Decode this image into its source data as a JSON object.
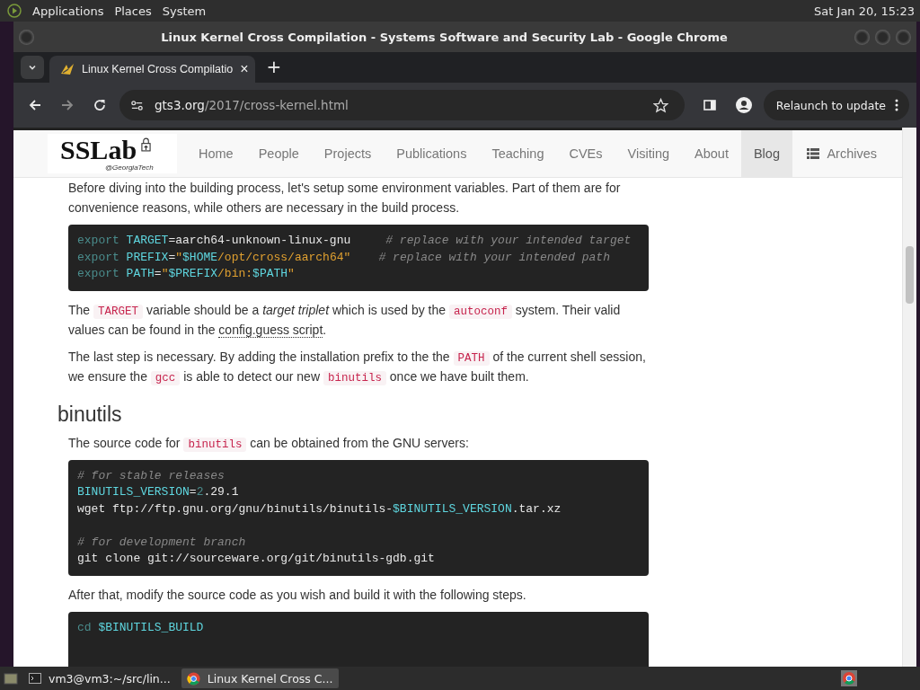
{
  "top_panel": {
    "menus": [
      "Applications",
      "Places",
      "System"
    ],
    "clock": "Sat Jan 20, 15:23"
  },
  "window": {
    "title": "Linux Kernel Cross Compilation - Systems Software and Security Lab - Google Chrome"
  },
  "tabs": [
    {
      "label": "Linux Kernel Cross Compilatio",
      "selected": true,
      "close": "×"
    }
  ],
  "new_tab": "+",
  "address": {
    "host": "gts3.org",
    "path": "/2017/cross-kernel.html"
  },
  "relaunch": "Relaunch to update",
  "site_nav": {
    "logo": "SSLab",
    "logo_sub": "@GeorgiaTech",
    "items": [
      {
        "label": "Home",
        "selected": false
      },
      {
        "label": "People",
        "selected": false
      },
      {
        "label": "Projects",
        "selected": false
      },
      {
        "label": "Publications",
        "selected": false
      },
      {
        "label": "Teaching",
        "selected": false
      },
      {
        "label": "CVEs",
        "selected": false
      },
      {
        "label": "Visiting",
        "selected": false
      },
      {
        "label": "About",
        "selected": false
      },
      {
        "label": "Blog",
        "selected": true
      }
    ],
    "archives": "Archives"
  },
  "content": [
    {
      "kind": "para",
      "segs": [
        {
          "kind": "text",
          "text": "Before diving into the building process, let's setup some environment variables. Part of them are for convenience reasons, while others are necessary in the build process."
        }
      ]
    },
    {
      "kind": "code",
      "lines": [
        {
          "segs": [
            {
              "kind": "keyword",
              "text": "export "
            },
            {
              "kind": "variable",
              "text": "TARGET"
            },
            {
              "kind": "plain",
              "text": "=aarch64-unknown-linux-gnu     "
            },
            {
              "kind": "comment",
              "text": "# replace with your intended target"
            }
          ]
        },
        {
          "segs": [
            {
              "kind": "keyword",
              "text": "export "
            },
            {
              "kind": "variable",
              "text": "PREFIX"
            },
            {
              "kind": "plain",
              "text": "="
            },
            {
              "kind": "string",
              "text": "\""
            },
            {
              "kind": "variable",
              "text": "$HOME"
            },
            {
              "kind": "string",
              "text": "/opt/cross/aarch64\"    "
            },
            {
              "kind": "comment",
              "text": "# replace with your intended path"
            }
          ]
        },
        {
          "segs": [
            {
              "kind": "keyword",
              "text": "export "
            },
            {
              "kind": "variable",
              "text": "PATH"
            },
            {
              "kind": "plain",
              "text": "="
            },
            {
              "kind": "string",
              "text": "\""
            },
            {
              "kind": "variable",
              "text": "$PREFIX"
            },
            {
              "kind": "string",
              "text": "/bin:"
            },
            {
              "kind": "variable",
              "text": "$PATH"
            },
            {
              "kind": "string",
              "text": "\""
            }
          ]
        }
      ]
    },
    {
      "kind": "para",
      "segs": [
        {
          "kind": "text",
          "text": "The "
        },
        {
          "kind": "code",
          "text": "TARGET"
        },
        {
          "kind": "text",
          "text": " variable should be a "
        },
        {
          "kind": "emphasis",
          "text": "target triplet"
        },
        {
          "kind": "text",
          "text": " which is used by the "
        },
        {
          "kind": "code",
          "text": "autoconf"
        },
        {
          "kind": "text",
          "text": " system. Their valid values can be found in the "
        },
        {
          "kind": "link",
          "text": "config.guess script"
        },
        {
          "kind": "text",
          "text": "."
        }
      ]
    },
    {
      "kind": "para",
      "segs": [
        {
          "kind": "text",
          "text": "The last step is necessary. By adding the installation prefix to the the "
        },
        {
          "kind": "code",
          "text": "PATH"
        },
        {
          "kind": "text",
          "text": " of the current shell session, we ensure the "
        },
        {
          "kind": "code",
          "text": "gcc"
        },
        {
          "kind": "text",
          "text": " is able to detect our new "
        },
        {
          "kind": "code",
          "text": "binutils"
        },
        {
          "kind": "text",
          "text": " once we have built them."
        }
      ]
    },
    {
      "kind": "heading",
      "text": "binutils"
    },
    {
      "kind": "para",
      "segs": [
        {
          "kind": "text",
          "text": "The source code for "
        },
        {
          "kind": "code",
          "text": "binutils"
        },
        {
          "kind": "text",
          "text": " can be obtained from the GNU servers:"
        }
      ]
    },
    {
      "kind": "code",
      "lines": [
        {
          "segs": [
            {
              "kind": "comment",
              "text": "# for stable releases"
            }
          ]
        },
        {
          "segs": [
            {
              "kind": "variable",
              "text": "BINUTILS_VERSION"
            },
            {
              "kind": "plain",
              "text": "="
            },
            {
              "kind": "number",
              "text": "2"
            },
            {
              "kind": "plain",
              "text": ".29.1"
            }
          ]
        },
        {
          "segs": [
            {
              "kind": "plain",
              "text": "wget ftp://ftp.gnu.org/gnu/binutils/binutils-"
            },
            {
              "kind": "variable",
              "text": "$BINUTILS_VERSION"
            },
            {
              "kind": "plain",
              "text": ".tar.xz"
            }
          ]
        },
        {
          "blank_before": true,
          "segs": [
            {
              "kind": "comment",
              "text": "# for development branch"
            }
          ]
        },
        {
          "segs": [
            {
              "kind": "plain",
              "text": "git clone git://sourceware.org/git/binutils-gdb.git"
            }
          ]
        }
      ]
    },
    {
      "kind": "para",
      "segs": [
        {
          "kind": "text",
          "text": "After that, modify the source code as you wish and build it with the following steps."
        }
      ]
    },
    {
      "kind": "code",
      "lines": [
        {
          "segs": [
            {
              "kind": "keyword",
              "text": "cd "
            },
            {
              "kind": "variable",
              "text": "$BINUTILS_BUILD"
            }
          ]
        }
      ]
    }
  ],
  "taskbar": [
    {
      "label": "vm3@vm3:~/src/lin...",
      "kind": "terminal",
      "selected": false
    },
    {
      "label": "Linux Kernel Cross C...",
      "kind": "browser",
      "selected": true
    }
  ]
}
